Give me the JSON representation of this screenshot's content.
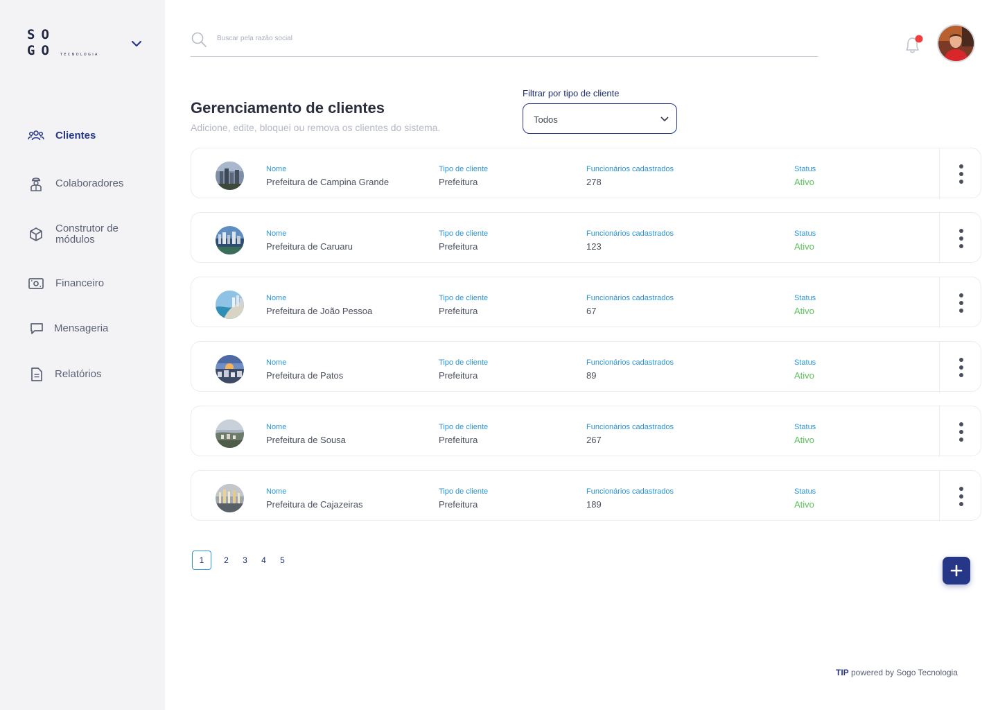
{
  "brand": {
    "logo_top": "SO",
    "logo_bottom": "GO",
    "logo_sub": "TECNOLOGIA"
  },
  "sidebar": {
    "items": [
      {
        "label": "Clientes",
        "icon": "users-icon",
        "active": true
      },
      {
        "label": "Colaboradores",
        "icon": "worker-icon",
        "active": false
      },
      {
        "label": "Construtor de módulos",
        "icon": "cube-icon",
        "active": false
      },
      {
        "label": "Financeiro",
        "icon": "money-icon",
        "active": false
      },
      {
        "label": "Mensageria",
        "icon": "chat-icon",
        "active": false
      },
      {
        "label": "Relatórios",
        "icon": "document-icon",
        "active": false
      }
    ]
  },
  "search": {
    "placeholder": "Buscar pela razão social",
    "value": ""
  },
  "header": {
    "has_notification": true,
    "notification_color": "#f03e3e"
  },
  "main": {
    "title": "Gerenciamento de clientes",
    "subtitle": "Adicione, edite, bloquei ou remova os clientes do sistema.",
    "filter": {
      "label": "Filtrar por tipo de cliente",
      "selected": "Todos"
    },
    "columns": {
      "name": "Nome",
      "type": "Tipo de cliente",
      "employees": "Funcionários cadastrados",
      "status": "Status"
    },
    "clients": [
      {
        "name": "Prefeitura de Campina Grande",
        "type": "Prefeitura",
        "employees": "278",
        "status": "Ativo"
      },
      {
        "name": "Prefeitura de Caruaru",
        "type": "Prefeitura",
        "employees": "123",
        "status": "Ativo"
      },
      {
        "name": "Prefeitura de João Pessoa",
        "type": "Prefeitura",
        "employees": "67",
        "status": "Ativo"
      },
      {
        "name": "Prefeitura de Patos",
        "type": "Prefeitura",
        "employees": "89",
        "status": "Ativo"
      },
      {
        "name": "Prefeitura de Sousa",
        "type": "Prefeitura",
        "employees": "267",
        "status": "Ativo"
      },
      {
        "name": "Prefeitura de Cajazeiras",
        "type": "Prefeitura",
        "employees": "189",
        "status": "Ativo"
      }
    ],
    "pagination": {
      "pages": [
        "1",
        "2",
        "3",
        "4",
        "5"
      ],
      "current": "1"
    }
  },
  "footer": {
    "brand": "TIP",
    "text": " powered by Sogo Tecnologia"
  },
  "colors": {
    "primary": "#273787",
    "label_blue": "#2a94d4",
    "status_green": "#5cc35c",
    "sidebar_bg": "#f3f3f6"
  }
}
